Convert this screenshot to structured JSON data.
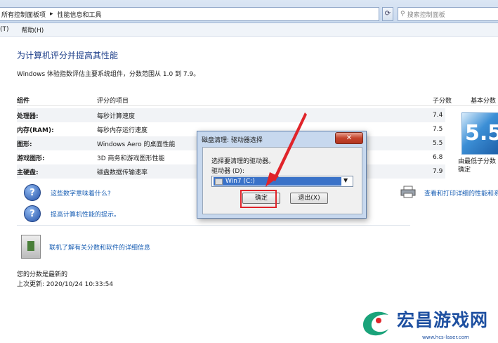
{
  "address_bar": {
    "crumbs": [
      "所有控制面板项",
      "▸",
      "性能信息和工具"
    ],
    "refresh_icon": "refresh-icon",
    "search_placeholder": "搜索控制面板"
  },
  "menu": {
    "items": [
      "(T)",
      "帮助(H)"
    ]
  },
  "page": {
    "title": "为计算机评分并提高其性能",
    "description": "Windows 体验指数评估主要系统组件，分数范围从 1.0 到 7.9。"
  },
  "table": {
    "headers": {
      "component": "组件",
      "rated_item": "评分的项目",
      "subscore": "子分数",
      "base_score": "基本分数"
    },
    "rows": [
      {
        "component": "处理器:",
        "item": "每秒计算速度",
        "subscore": "7.4"
      },
      {
        "component": "内存(RAM):",
        "item": "每秒内存运行速度",
        "subscore": "7.5"
      },
      {
        "component": "图形:",
        "item": "Windows Aero 的桌面性能",
        "subscore": "5.5"
      },
      {
        "component": "游戏图形:",
        "item": "3D 商务和游戏图形性能",
        "subscore": "6.8"
      },
      {
        "component": "主硬盘:",
        "item": "磁盘数据传输速率",
        "subscore": "7.9"
      }
    ],
    "base_score": "5.5",
    "base_caption": "由最低子分数确定"
  },
  "links": {
    "what_mean": "这些数字意味着什么?",
    "tips": "提高计算机性能的提示。",
    "print_details": "查看和打印详细的性能和系统",
    "online_info": "联机了解有关分数和软件的详细信息"
  },
  "status": {
    "line1": "您的分数是最新的",
    "line2": "上次更新: 2020/10/24 10:33:54"
  },
  "dialog": {
    "title": "磁盘清理: 驱动器选择",
    "close": "✕",
    "prompt": "选择要清理的驱动器。",
    "drives_label": "驱动器 (D):",
    "selected_drive": "Win7 (C:)",
    "ok": "确定",
    "cancel": "退出(X)"
  },
  "watermark": {
    "text": "宏昌游戏网",
    "url": "www.hcs-laser.com"
  },
  "colors": {
    "accent": "#1a5fb4",
    "highlight_red": "#e0242a",
    "score_badge": "#2a6fc0"
  }
}
